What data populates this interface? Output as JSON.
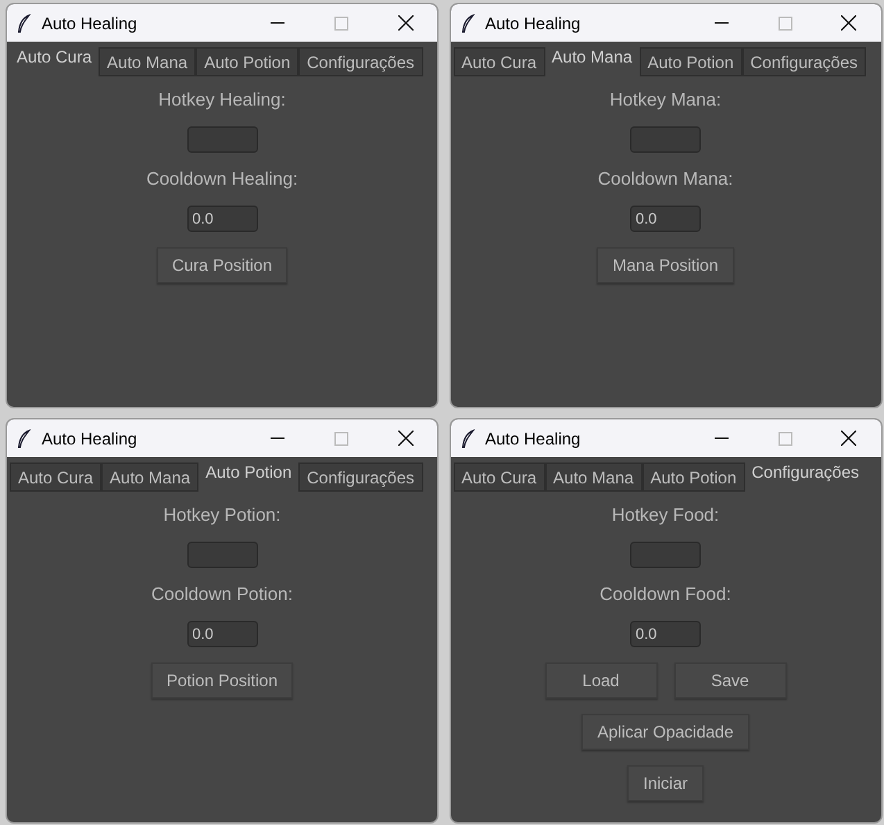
{
  "windows": [
    {
      "title": "Auto Healing",
      "tabs": [
        {
          "label": "Auto Cura",
          "selected": true
        },
        {
          "label": "Auto Mana",
          "selected": false
        },
        {
          "label": "Auto Potion",
          "selected": false
        },
        {
          "label": "Configurações",
          "selected": false
        }
      ],
      "items": [
        {
          "kind": "label",
          "text": "Hotkey Healing:"
        },
        {
          "kind": "field"
        },
        {
          "kind": "label",
          "text": "Cooldown Healing:"
        },
        {
          "kind": "field",
          "value": "0.0"
        },
        {
          "kind": "buttons",
          "buttons": [
            "Cura Position"
          ]
        }
      ]
    },
    {
      "title": "Auto Healing",
      "tabs": [
        {
          "label": "Auto Cura",
          "selected": false
        },
        {
          "label": "Auto Mana",
          "selected": true
        },
        {
          "label": "Auto Potion",
          "selected": false
        },
        {
          "label": "Configurações",
          "selected": false
        }
      ],
      "items": [
        {
          "kind": "label",
          "text": "Hotkey Mana:"
        },
        {
          "kind": "field"
        },
        {
          "kind": "label",
          "text": "Cooldown Mana:"
        },
        {
          "kind": "field",
          "value": "0.0"
        },
        {
          "kind": "buttons",
          "buttons": [
            "Mana Position"
          ]
        }
      ]
    },
    {
      "title": "Auto Healing",
      "tabs": [
        {
          "label": "Auto Cura",
          "selected": false
        },
        {
          "label": "Auto Mana",
          "selected": false
        },
        {
          "label": "Auto Potion",
          "selected": true
        },
        {
          "label": "Configurações",
          "selected": false
        }
      ],
      "items": [
        {
          "kind": "label",
          "text": "Hotkey Potion:"
        },
        {
          "kind": "field"
        },
        {
          "kind": "label",
          "text": "Cooldown Potion:"
        },
        {
          "kind": "field",
          "value": "0.0"
        },
        {
          "kind": "buttons",
          "buttons": [
            "Potion Position"
          ]
        }
      ]
    },
    {
      "title": "Auto Healing",
      "tabs": [
        {
          "label": "Auto Cura",
          "selected": false
        },
        {
          "label": "Auto Mana",
          "selected": false
        },
        {
          "label": "Auto Potion",
          "selected": false
        },
        {
          "label": "Configurações",
          "selected": true
        }
      ],
      "items": [
        {
          "kind": "label",
          "text": "Hotkey Food:"
        },
        {
          "kind": "field"
        },
        {
          "kind": "label",
          "text": "Cooldown Food:"
        },
        {
          "kind": "field",
          "value": "0.0"
        },
        {
          "kind": "buttons",
          "buttons": [
            "Load",
            "Save"
          ]
        },
        {
          "kind": "buttons",
          "buttons": [
            "Aplicar Opacidade"
          ]
        },
        {
          "kind": "buttons",
          "buttons": [
            "Iniciar"
          ]
        }
      ]
    }
  ]
}
